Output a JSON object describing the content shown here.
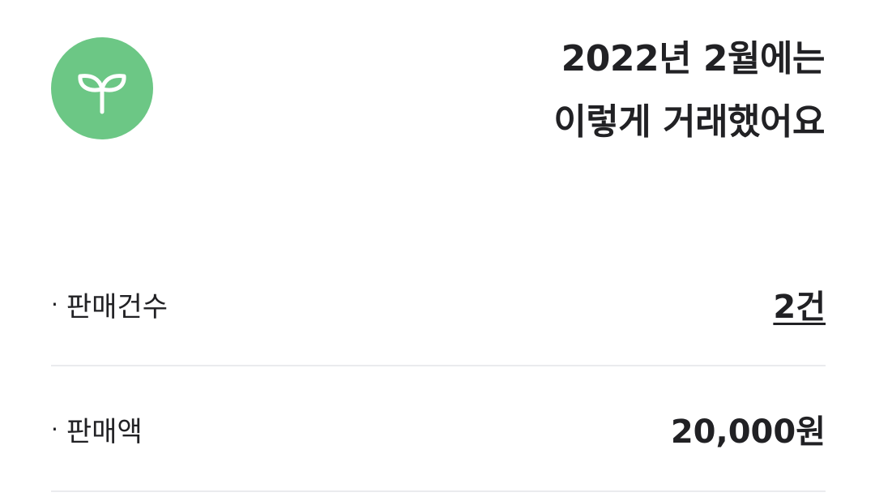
{
  "header": {
    "icon": "sprout-icon",
    "icon_bg_color": "#6cc785",
    "title_line1": "2022년 2월에는",
    "title_line2": "이렇게 거래했어요"
  },
  "stats": [
    {
      "bullet": "·",
      "label": "판매건수",
      "value": "2건",
      "is_link": true
    },
    {
      "bullet": "·",
      "label": "판매액",
      "value": "20,000원",
      "is_link": false
    }
  ]
}
